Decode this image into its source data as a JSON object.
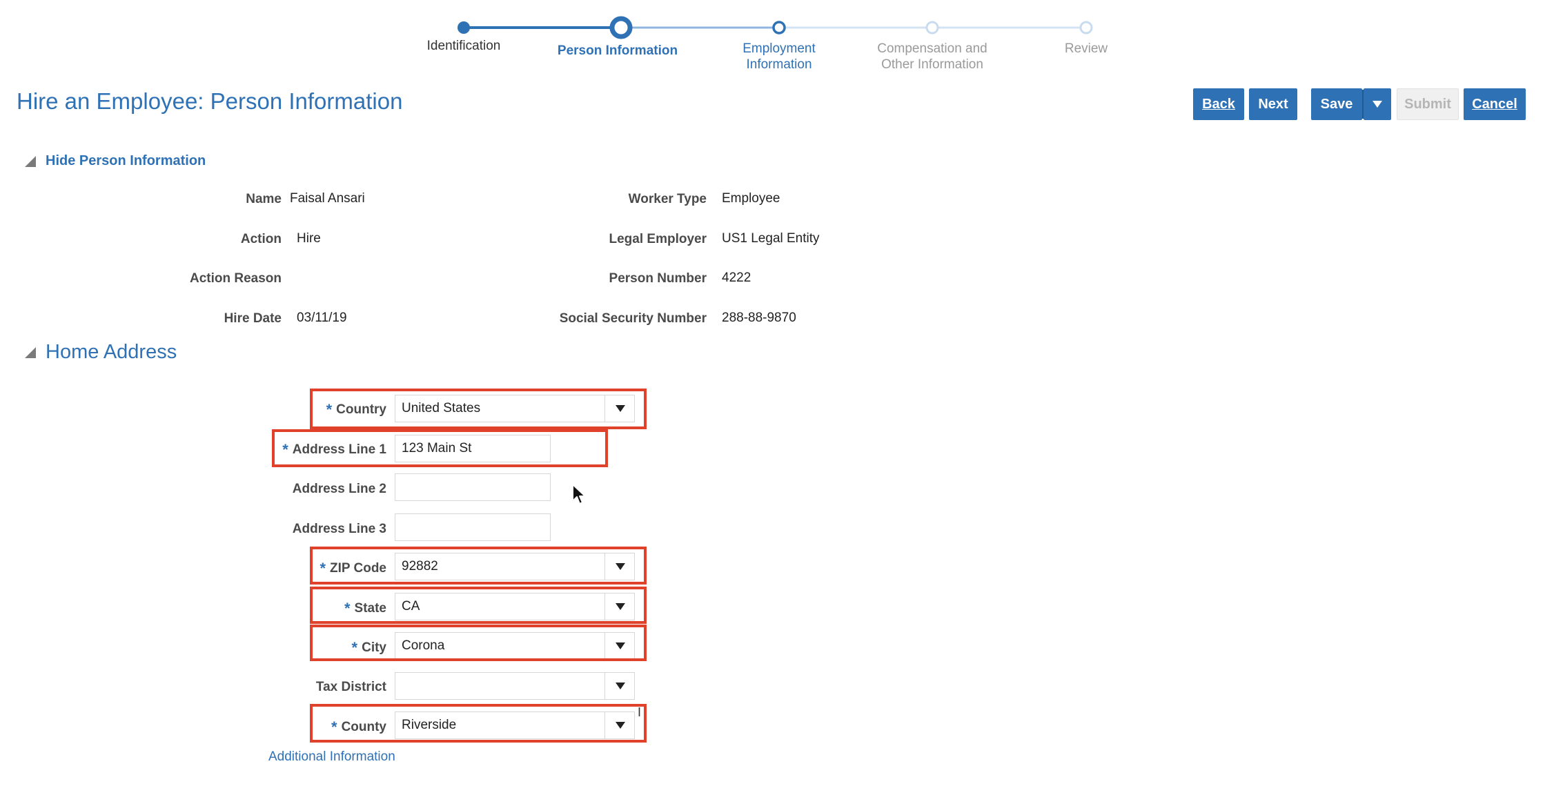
{
  "train": {
    "steps": [
      {
        "label_line1": "Identification",
        "label_line2": "",
        "state": "done"
      },
      {
        "label_line1": "Person Information",
        "label_line2": "",
        "state": "current"
      },
      {
        "label_line1": "Employment",
        "label_line2": "Information",
        "state": "next"
      },
      {
        "label_line1": "Compensation and",
        "label_line2": "Other Information",
        "state": "future"
      },
      {
        "label_line1": "Review",
        "label_line2": "",
        "state": "future"
      }
    ]
  },
  "page": {
    "title": "Hire an Employee: Person Information"
  },
  "toolbar": {
    "back_label": "Back",
    "next_label": "Next",
    "save_label": "Save",
    "submit_label": "Submit",
    "cancel_label": "Cancel"
  },
  "person_info": {
    "toggle_label": "Hide Person Information",
    "name_label": "Name",
    "name_value": "Faisal Ansari",
    "action_label": "Action",
    "action_value": "Hire",
    "action_reason_label": "Action Reason",
    "action_reason_value": "",
    "hire_date_label": "Hire Date",
    "hire_date_value": "03/11/19",
    "worker_type_label": "Worker Type",
    "worker_type_value": "Employee",
    "legal_employer_label": "Legal Employer",
    "legal_employer_value": "US1 Legal Entity",
    "person_number_label": "Person Number",
    "person_number_value": "4222",
    "ssn_label": "Social Security Number",
    "ssn_value": "288-88-9870"
  },
  "home_address": {
    "heading": "Home Address",
    "country_label": "Country",
    "country_value": "United States",
    "address_line1_label": "Address Line 1",
    "address_line1_value": "123 Main St",
    "address_line2_label": "Address Line 2",
    "address_line2_value": "",
    "address_line3_label": "Address Line 3",
    "address_line3_value": "",
    "zip_label": "ZIP Code",
    "zip_value": "92882",
    "state_label": "State",
    "state_value": "CA",
    "city_label": "City",
    "city_value": "Corona",
    "tax_district_label": "Tax District",
    "tax_district_value": "",
    "county_label": "County",
    "county_value": "Riverside",
    "additional_info_link": "Additional Information"
  },
  "colors": {
    "accent": "#2f71b5",
    "highlight": "#e0412b"
  }
}
